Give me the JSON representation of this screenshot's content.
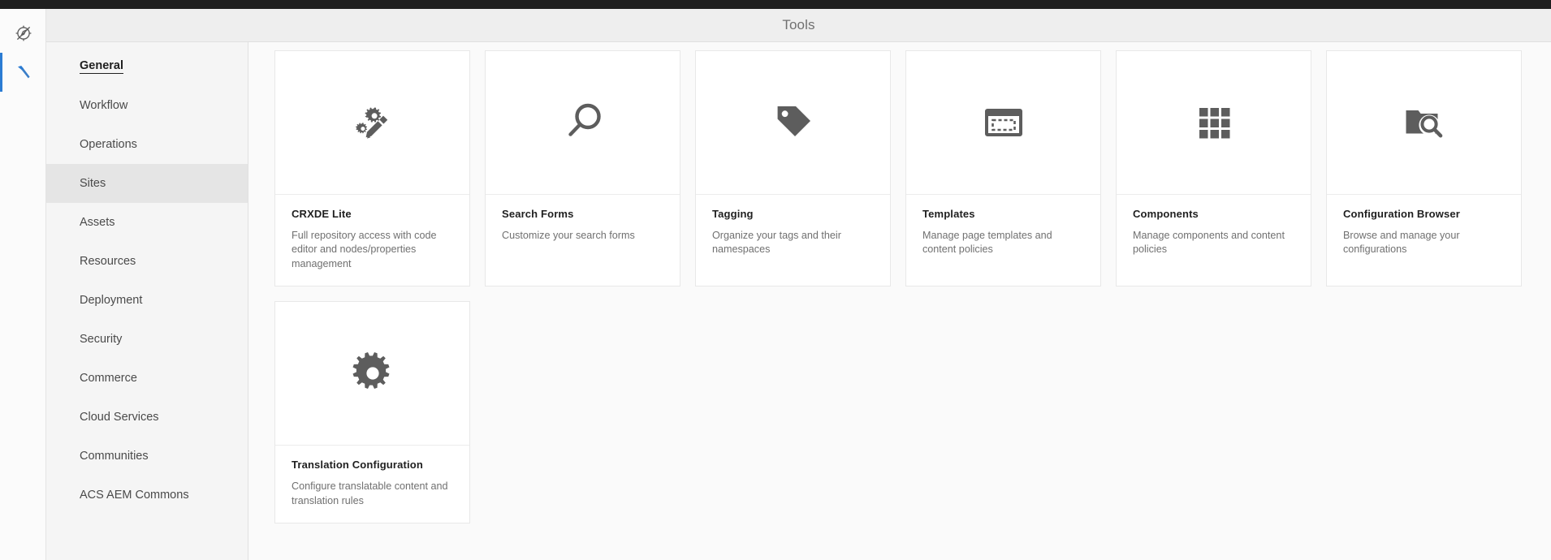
{
  "header": {
    "title": "Tools"
  },
  "rail": {
    "items": [
      {
        "name": "compass-disabled-icon",
        "label": "Navigation",
        "active": false
      },
      {
        "name": "hammer-icon",
        "label": "Tools",
        "active": true
      }
    ],
    "accent_color": "#2b7cd3"
  },
  "sidebar": {
    "items": [
      {
        "label": "General",
        "state": "hovered"
      },
      {
        "label": "Workflow",
        "state": "default"
      },
      {
        "label": "Operations",
        "state": "default"
      },
      {
        "label": "Sites",
        "state": "selected"
      },
      {
        "label": "Assets",
        "state": "default"
      },
      {
        "label": "Resources",
        "state": "default"
      },
      {
        "label": "Deployment",
        "state": "default"
      },
      {
        "label": "Security",
        "state": "default"
      },
      {
        "label": "Commerce",
        "state": "default"
      },
      {
        "label": "Cloud Services",
        "state": "default"
      },
      {
        "label": "Communities",
        "state": "default"
      },
      {
        "label": "ACS AEM Commons",
        "state": "default"
      }
    ]
  },
  "main": {
    "cards": [
      {
        "title": "CRXDE Lite",
        "description": "Full repository access with code editor and nodes/properties management",
        "icon": "gears-pencil-icon"
      },
      {
        "title": "Search Forms",
        "description": "Customize your search forms",
        "icon": "magnifier-icon"
      },
      {
        "title": "Tagging",
        "description": "Organize your tags and their namespaces",
        "icon": "tag-icon"
      },
      {
        "title": "Templates",
        "description": "Manage page templates and content policies",
        "icon": "template-icon"
      },
      {
        "title": "Components",
        "description": "Manage components and content policies",
        "icon": "grid-squares-icon"
      },
      {
        "title": "Configuration Browser",
        "description": "Browse and manage your configurations",
        "icon": "folder-search-icon"
      },
      {
        "title": "Translation Configuration",
        "description": "Configure translatable content and translation rules",
        "icon": "gear-icon"
      }
    ]
  },
  "colors": {
    "page_background": "#fafafa",
    "header_background": "#eeeeee",
    "sidebar_background": "#f5f5f5",
    "card_background": "#ffffff",
    "icon_gray": "#5d5d5d",
    "accent_blue": "#2b7cd3",
    "topbar": "#1f1f1f"
  }
}
